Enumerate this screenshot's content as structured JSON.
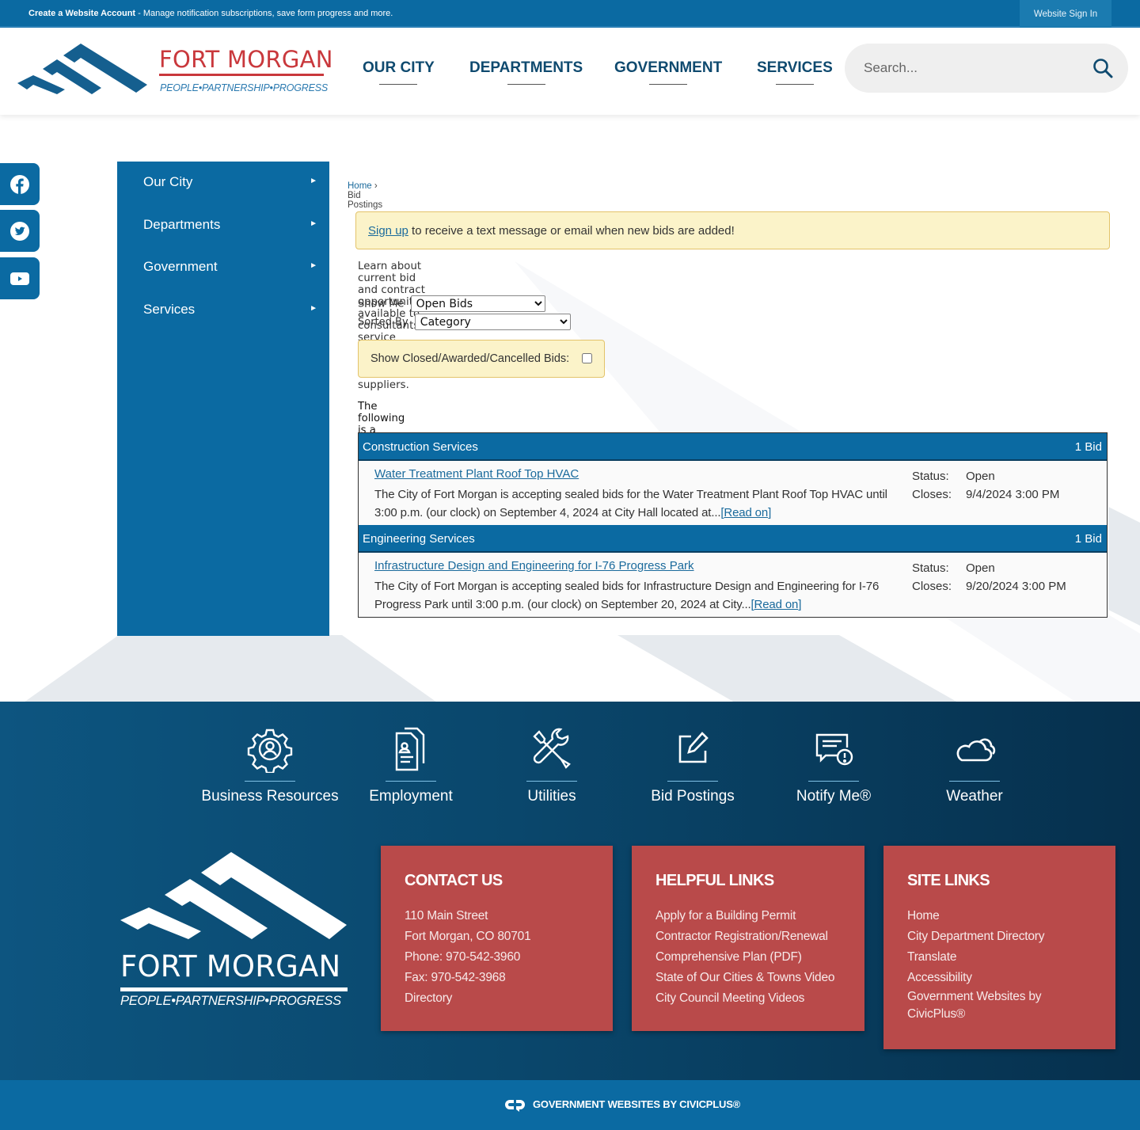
{
  "topbar": {
    "account_link": "Create a Website Account",
    "account_message": " - Manage notification subscriptions, save form progress and more.",
    "sign_in": "Website Sign In"
  },
  "header": {
    "logo_name": "FORT MORGAN",
    "logo_tagline": "PEOPLE•PARTNERSHIP•PROGRESS",
    "nav": [
      {
        "label": "OUR CITY"
      },
      {
        "label": "DEPARTMENTS"
      },
      {
        "label": "GOVERNMENT"
      },
      {
        "label": "SERVICES"
      }
    ],
    "search": {
      "placeholder": "Search...",
      "value": "",
      "icon": "search-icon"
    }
  },
  "social": [
    {
      "name": "facebook",
      "icon": "facebook-icon"
    },
    {
      "name": "twitter",
      "icon": "twitter-icon"
    },
    {
      "name": "youtube",
      "icon": "youtube-icon"
    }
  ],
  "sidebar": {
    "items": [
      {
        "label": "Our City",
        "arrow": "►"
      },
      {
        "label": "Departments",
        "arrow": "►"
      },
      {
        "label": "Government",
        "arrow": "►"
      },
      {
        "label": "Services",
        "arrow": "►"
      }
    ]
  },
  "breadcrumb": {
    "home": "Home",
    "separator": "›",
    "current": "Bid Postings"
  },
  "alert": {
    "link": "Sign up",
    "text": " to receive a text message or email when new bids are added!"
  },
  "intro": "Learn about current bid and contract opportunities available to consultants, service providers, contractors, vendors, or suppliers.",
  "filters": {
    "show_me_label": "Show Me",
    "show_me_value": "Open Bids",
    "sorted_by_label": "Sorted By",
    "sorted_by_value": "Category",
    "closed_label": "Show Closed/Awarded/Cancelled Bids:",
    "closed_checked": false
  },
  "listing_intro": "The following is a listing of various bid postings. Click on any of the titles for the details on that particular bid.",
  "categories": [
    {
      "name": "Construction Services",
      "count": "1 Bid",
      "bids": [
        {
          "title": "Water Treatment Plant Roof Top HVAC",
          "description": "The City of Fort Morgan is accepting sealed bids for the Water Treatment Plant Roof Top HVAC until 3:00 p.m. (our clock) on September 4, 2024 at City Hall located at...",
          "read_on": "Read on",
          "status_label": "Status:",
          "status": "Open",
          "closes_label": "Closes:",
          "closes": "9/4/2024 3:00 PM"
        }
      ]
    },
    {
      "name": "Engineering Services",
      "count": "1 Bid",
      "bids": [
        {
          "title": "Infrastructure Design and Engineering for I-76 Progress Park",
          "description": "The City of Fort Morgan is accepting sealed bids for Infrastructure Design and Engineering for I-76 Progress Park until 3:00 p.m. (our clock) on September 20, 2024 at City...",
          "read_on": "Read on",
          "status_label": "Status:",
          "status": "Open",
          "closes_label": "Closes:",
          "closes": "9/20/2024 3:00 PM"
        }
      ]
    }
  ],
  "footer": {
    "quick_links": [
      {
        "label": "Business Resources",
        "icon": "gear-person-icon"
      },
      {
        "label": "Employment",
        "icon": "resume-document-icon"
      },
      {
        "label": "Utilities",
        "icon": "tools-icon"
      },
      {
        "label": "Bid Postings",
        "icon": "edit-square-icon"
      },
      {
        "label": "Notify Me®",
        "icon": "alert-message-icon"
      },
      {
        "label": "Weather",
        "icon": "cloud-icon"
      }
    ],
    "logo_name": "FORT MORGAN",
    "logo_tagline": "PEOPLE•PARTNERSHIP•PROGRESS",
    "contact": {
      "title": "CONTACT US",
      "lines": [
        "110 Main Street",
        "Fort Morgan, CO 80701",
        "Phone: 970-542-3960",
        "Fax: 970-542-3968",
        "Directory"
      ]
    },
    "helpful_links": {
      "title": "HELPFUL LINKS",
      "links": [
        "Apply for a Building Permit",
        "Contractor Registration/Renewal",
        "Comprehensive Plan (PDF)",
        "State of Our Cities & Towns Video",
        "City Council Meeting Videos"
      ]
    },
    "site_links": {
      "title": "SITE LINKS",
      "links": [
        "Home",
        "City Department Directory",
        "Translate",
        "Accessibility",
        "Government Websites by",
        "CivicPlus®"
      ]
    },
    "civicplus": "GOVERNMENT WEBSITES BY CIVICPLUS®"
  },
  "colors": {
    "brand_blue": "#0b6aa2",
    "brand_red": "#c9383c",
    "footer_box_red": "#b94a4a",
    "alert_yellow": "#fbf3c9",
    "link_blue": "#1a6a9c",
    "nav_text": "#0f4a6f"
  }
}
